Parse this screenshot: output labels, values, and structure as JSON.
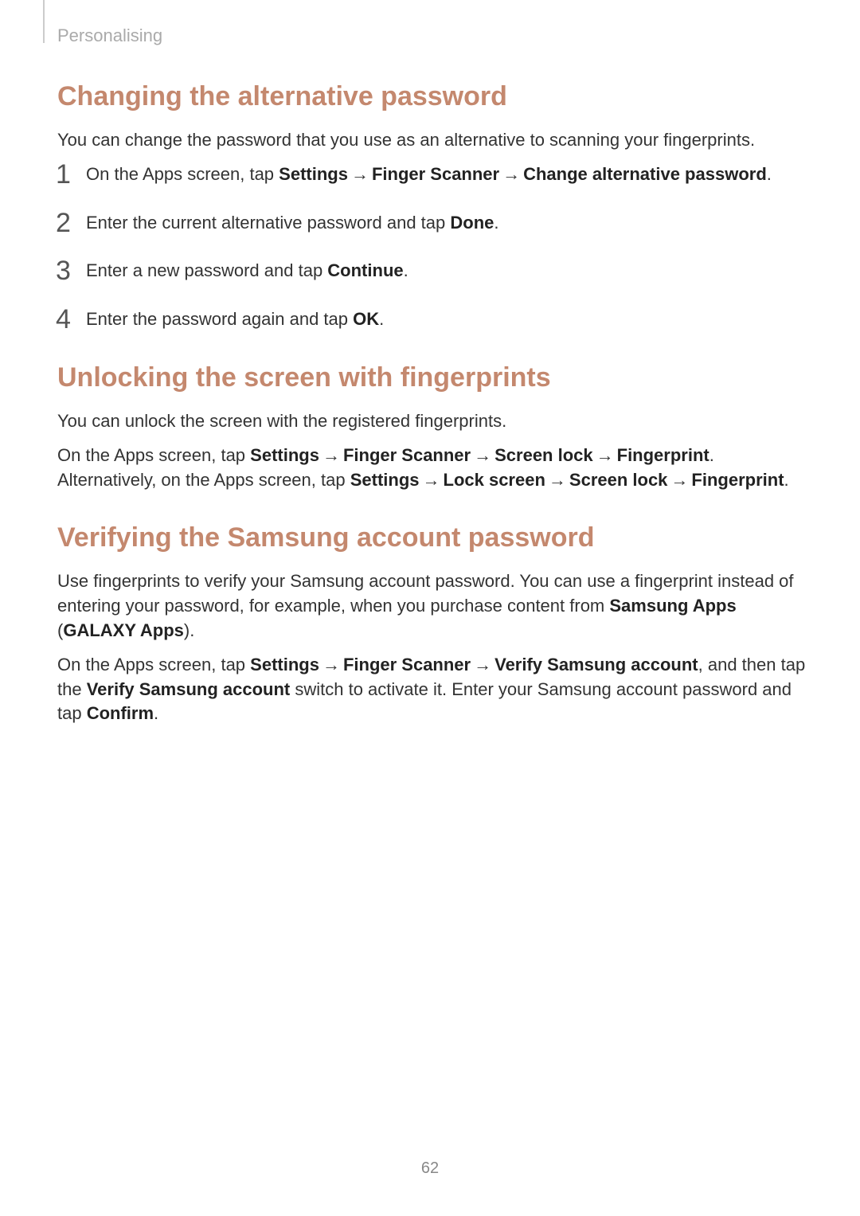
{
  "breadcrumb": "Personalising",
  "arrow": "→",
  "section1": {
    "title": "Changing the alternative password",
    "intro": "You can change the password that you use as an alternative to scanning your fingerprints.",
    "steps": [
      {
        "before": "On the Apps screen, tap ",
        "boldpath": [
          "Settings",
          "Finger Scanner",
          "Change alternative password"
        ],
        "after": "."
      },
      {
        "before": "Enter the current alternative password and tap ",
        "boldpath": [
          "Done"
        ],
        "after": "."
      },
      {
        "before": "Enter a new password and tap ",
        "boldpath": [
          "Continue"
        ],
        "after": "."
      },
      {
        "before": "Enter the password again and tap ",
        "boldpath": [
          "OK"
        ],
        "after": "."
      }
    ]
  },
  "section2": {
    "title": "Unlocking the screen with fingerprints",
    "intro": "You can unlock the screen with the registered fingerprints.",
    "para2": {
      "p1_before": "On the Apps screen, tap ",
      "p1_path": [
        "Settings",
        "Finger Scanner",
        "Screen lock",
        "Fingerprint"
      ],
      "p1_after": ". Alternatively, on the Apps screen, tap ",
      "p2_path": [
        "Settings",
        "Lock screen",
        "Screen lock",
        "Fingerprint"
      ],
      "p2_after": "."
    }
  },
  "section3": {
    "title": "Verifying the Samsung account password",
    "para1": {
      "t1": "Use fingerprints to verify your Samsung account password. You can use a fingerprint instead of entering your password, for example, when you purchase content from ",
      "b1": "Samsung Apps",
      "t2": " (",
      "b2": "GALAXY Apps",
      "t3": ")."
    },
    "para2": {
      "t1": "On the Apps screen, tap ",
      "path": [
        "Settings",
        "Finger Scanner",
        "Verify Samsung account"
      ],
      "t2": ", and then tap the ",
      "b1": "Verify Samsung account",
      "t3": " switch to activate it. Enter your Samsung account password and tap ",
      "b2": "Confirm",
      "t4": "."
    }
  },
  "pageNumber": "62"
}
